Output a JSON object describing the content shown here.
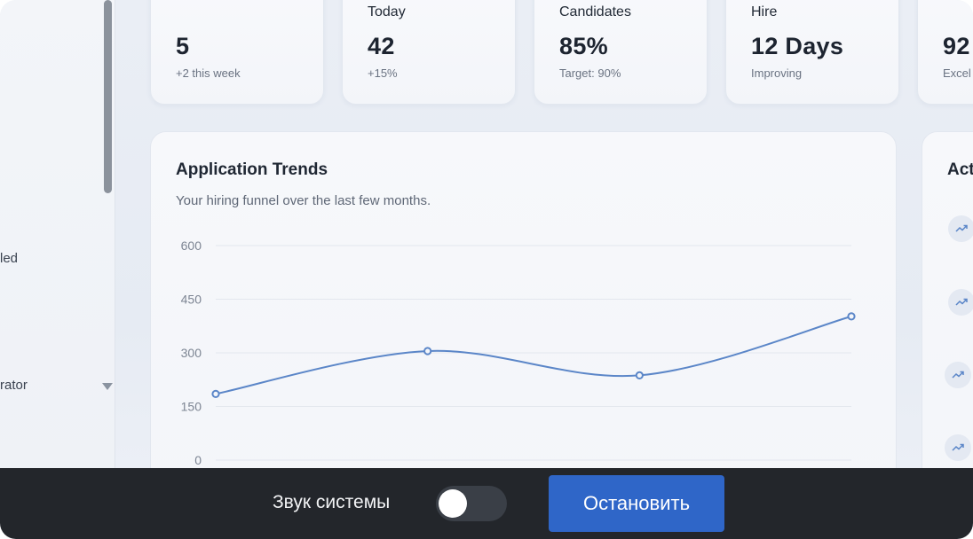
{
  "sidebar": {
    "items": [
      {
        "label": "led"
      },
      {
        "label": "rator"
      }
    ]
  },
  "stats": [
    {
      "label": "",
      "value": "5",
      "sub": "+2 this week",
      "icon": ""
    },
    {
      "label": "Today",
      "value": "42",
      "sub": "+15%",
      "icon": "users-icon"
    },
    {
      "label": "Candidates",
      "value": "85%",
      "sub": "Target: 90%",
      "icon": "check-circle-icon"
    },
    {
      "label": "Hire",
      "value": "12 Days",
      "sub": "Improving",
      "icon": "clock-icon"
    },
    {
      "label": "",
      "value": "92",
      "sub": "Excel",
      "icon": ""
    }
  ],
  "trends": {
    "title": "Application Trends",
    "subtitle": "Your hiring funnel over the last few months."
  },
  "chart_data": {
    "type": "line",
    "title": "Application Trends",
    "xlabel": "",
    "ylabel": "",
    "ylim": [
      0,
      600
    ],
    "yticks": [
      "600",
      "450",
      "300",
      "150",
      "0"
    ],
    "grid": true,
    "series": [
      {
        "values": [
          185,
          305,
          237,
          402
        ]
      }
    ],
    "color": "#5b86c8"
  },
  "activity": {
    "title": "Act"
  },
  "bottombar": {
    "sound_label": "Звук системы",
    "stop_label": "Остановить",
    "toggle_on": false
  },
  "colors": {
    "accent": "#2f66c8",
    "bar": "#23262b"
  }
}
